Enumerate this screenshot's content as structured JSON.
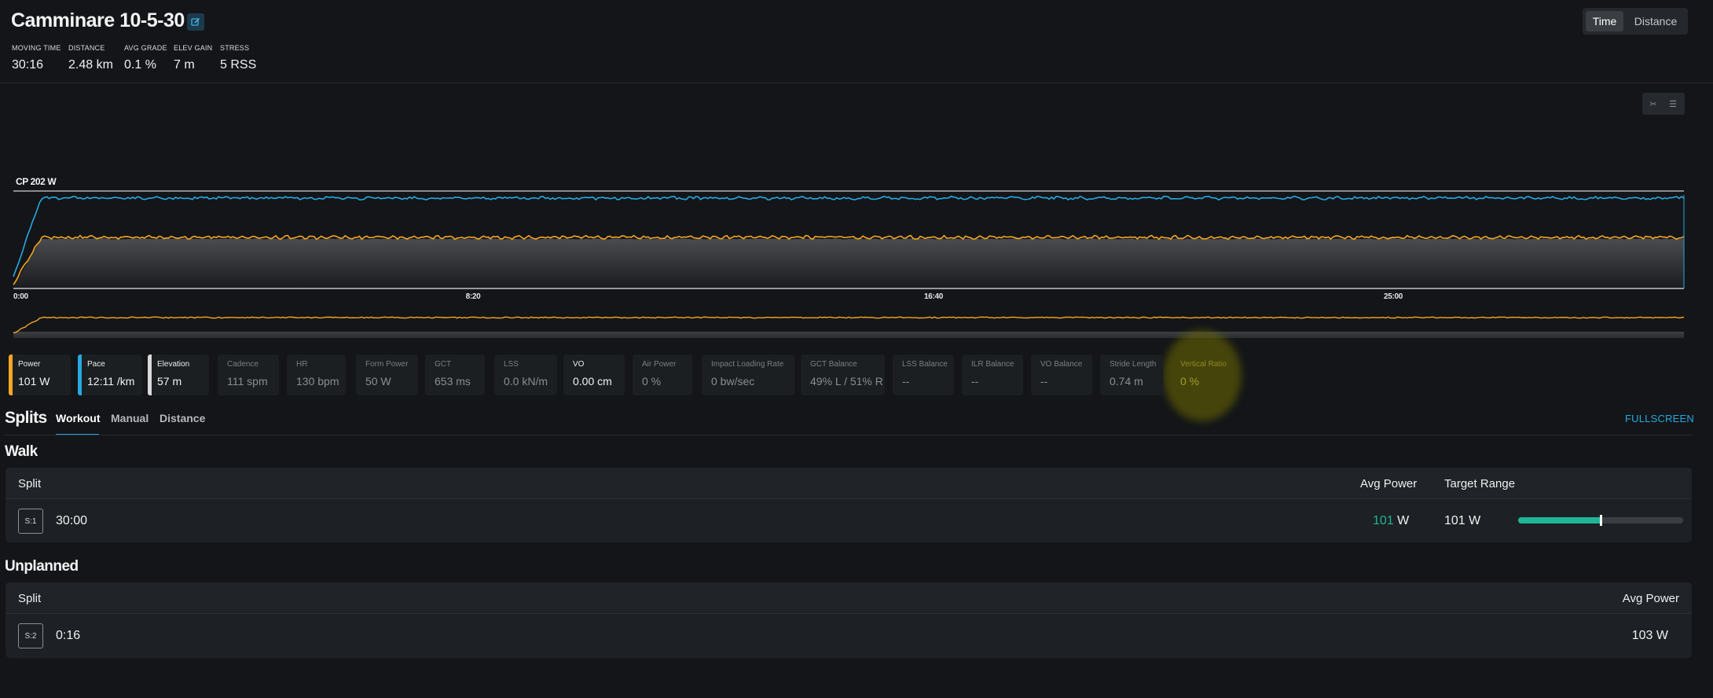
{
  "activity": {
    "title": "Camminare 10-5-30"
  },
  "metrics": [
    {
      "label": "MOVING TIME",
      "value": "30:16"
    },
    {
      "label": "DISTANCE",
      "value": "2.48 km"
    },
    {
      "label": "AVG GRADE",
      "value": "0.1 %"
    },
    {
      "label": "ELEV GAIN",
      "value": "7 m"
    },
    {
      "label": "STRESS",
      "value": "5 RSS"
    }
  ],
  "view_toggle": {
    "time": "Time",
    "distance": "Distance",
    "selected": "Time"
  },
  "chart": {
    "cp_label": "CP 202 W",
    "x_ticks": [
      "0:00",
      "8:20",
      "16:40",
      "25:00"
    ],
    "colors": {
      "power": "#f5a623",
      "pace": "#27a9e1",
      "axis": "#ffffff"
    }
  },
  "chart_data": {
    "type": "line",
    "x_unit": "minutes",
    "x_range": [
      0,
      30.3
    ],
    "x_tick_labels": [
      "0:00",
      "8:20",
      "16:40",
      "25:00"
    ],
    "reference_line": {
      "label": "CP 202 W",
      "value": 202
    },
    "series": [
      {
        "name": "Power",
        "unit": "W",
        "color": "#f5a623",
        "approx_level": 101
      },
      {
        "name": "Pace",
        "unit": "/km",
        "color": "#27a9e1",
        "approx_level": "12:11 /km"
      },
      {
        "name": "Elevation",
        "unit": "m",
        "approx_level": 57
      }
    ]
  },
  "stat_cards": [
    {
      "label": "Power",
      "value": "101 W",
      "color": "#f5a623",
      "active": true
    },
    {
      "label": "Pace",
      "value": "12:11 /km",
      "color": "#27a9e1",
      "active": true
    },
    {
      "label": "Elevation",
      "value": "57 m",
      "color": "#d9d9d9",
      "active": true
    },
    {
      "label": "Cadence",
      "value": "111 spm",
      "active": false
    },
    {
      "label": "HR",
      "value": "130 bpm",
      "active": false
    },
    {
      "label": "Form Power",
      "value": "50 W",
      "active": false
    },
    {
      "label": "GCT",
      "value": "653 ms",
      "active": false
    },
    {
      "label": "LSS",
      "value": "0.0 kN/m",
      "active": false
    },
    {
      "label": "VO",
      "value": "0.00 cm",
      "active": true
    },
    {
      "label": "Air Power",
      "value": "0 %",
      "active": false
    },
    {
      "label": "Impact Loading Rate",
      "value": "0 bw/sec",
      "active": false
    },
    {
      "label": "GCT Balance",
      "value": "49% L / 51% R",
      "active": false
    },
    {
      "label": "LSS Balance",
      "value": "--",
      "active": false
    },
    {
      "label": "ILR Balance",
      "value": "--",
      "active": false
    },
    {
      "label": "VO Balance",
      "value": "--",
      "active": false
    },
    {
      "label": "Stride Length",
      "value": "0.74 m",
      "active": false
    },
    {
      "label": "Vertical Ratio",
      "value": "0 %",
      "active": false
    }
  ],
  "splits": {
    "title": "Splits",
    "tabs": [
      "Workout",
      "Manual",
      "Distance"
    ],
    "active_tab": "Workout",
    "fullscreen": "FULLSCREEN"
  },
  "walk": {
    "title": "Walk",
    "headers": {
      "split": "Split",
      "avg_power": "Avg Power",
      "target_range": "Target Range"
    },
    "rows": [
      {
        "badge": "S:1",
        "duration": "30:00",
        "avg_power_num": "101",
        "avg_power_unit": "W",
        "target": "101 W",
        "range_fill_fraction": 0.5
      }
    ]
  },
  "unplanned": {
    "title": "Unplanned",
    "headers": {
      "split": "Split",
      "avg_power": "Avg Power"
    },
    "rows": [
      {
        "badge": "S:2",
        "duration": "0:16",
        "avg_power": "103 W"
      }
    ]
  }
}
